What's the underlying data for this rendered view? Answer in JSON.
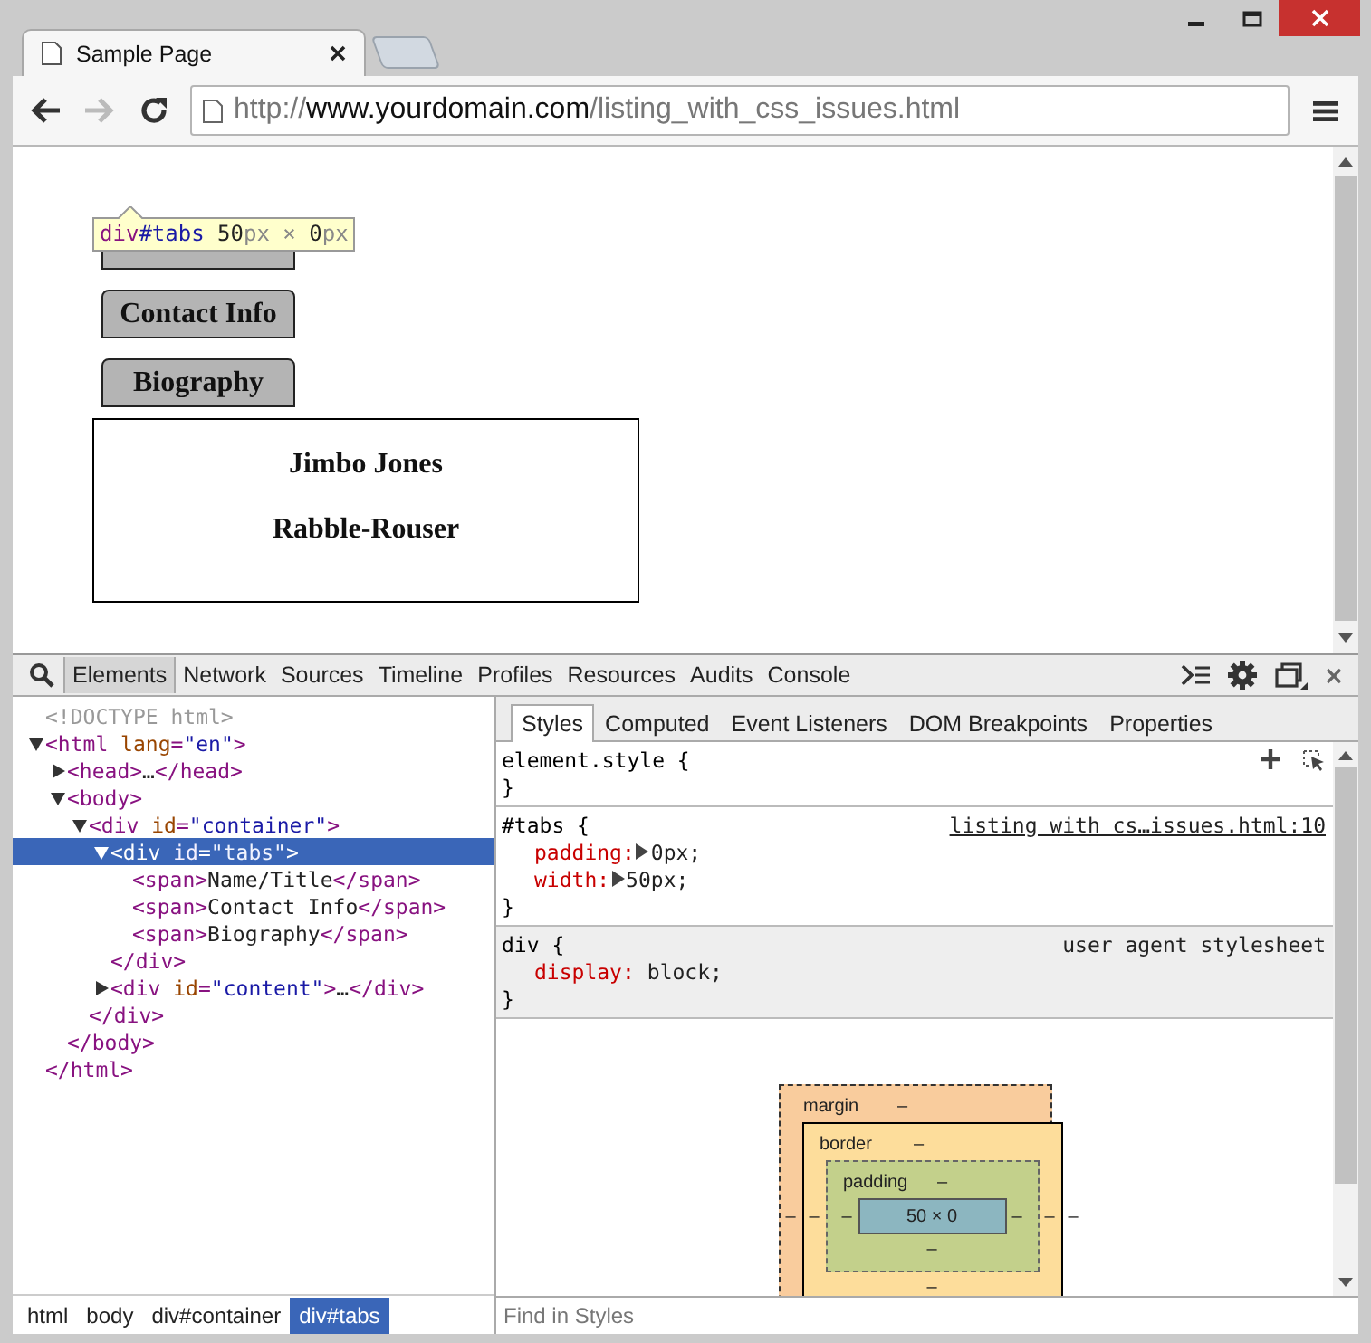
{
  "browser_tabs": [
    {
      "title": "Sample Page",
      "selected": true
    }
  ],
  "navigation": {
    "back_enabled": true,
    "forward_enabled": false
  },
  "address_bar": {
    "scheme": "http://",
    "host": "www.yourdomain.com",
    "path": "/listing_with_css_issues.html"
  },
  "page": {
    "tabs": [
      {
        "kind": "covered"
      },
      {
        "kind": "labeled",
        "label": "Contact Info"
      },
      {
        "kind": "labeled",
        "label": "Biography"
      }
    ],
    "content": [
      "Jimbo Jones",
      "Rabble-Rouser"
    ],
    "tooltip": [
      {
        "kind": "tag",
        "text": "div"
      },
      {
        "kind": "value",
        "text": "#tabs"
      },
      {
        "kind": "text",
        "text": " 50"
      },
      {
        "kind": "unit",
        "text": "px × "
      },
      {
        "kind": "text",
        "text": "0"
      },
      {
        "kind": "unit",
        "text": "px"
      }
    ]
  },
  "devtools": {
    "tabs": [
      {
        "label": "Elements",
        "selected": true
      },
      {
        "label": "Network",
        "selected": false
      },
      {
        "label": "Sources",
        "selected": false
      },
      {
        "label": "Timeline",
        "selected": false
      },
      {
        "label": "Profiles",
        "selected": false
      },
      {
        "label": "Resources",
        "selected": false
      },
      {
        "label": "Audits",
        "selected": false
      },
      {
        "label": "Console",
        "selected": false
      }
    ],
    "dom_tree": [
      {
        "selected": false,
        "tokens": [
          {
            "kind": "doctype",
            "text": "<!DOCTYPE html>"
          }
        ]
      },
      {
        "selected": false,
        "expanded": true,
        "tokens": [
          {
            "kind": "tag",
            "text": "<html "
          },
          {
            "kind": "attr",
            "text": "lang"
          },
          {
            "kind": "tag",
            "text": "="
          },
          {
            "kind": "value",
            "text": "\"en\""
          },
          {
            "kind": "tag",
            "text": ">"
          }
        ],
        "close": [
          {
            "kind": "tag",
            "text": "</html>"
          }
        ],
        "children": [
          {
            "selected": false,
            "expanded": false,
            "tokens": [
              {
                "kind": "tag",
                "text": "<head>"
              },
              {
                "kind": "text",
                "text": "…"
              },
              {
                "kind": "tag",
                "text": "</head>"
              }
            ]
          },
          {
            "selected": false,
            "expanded": true,
            "tokens": [
              {
                "kind": "tag",
                "text": "<body>"
              }
            ],
            "close": [
              {
                "kind": "tag",
                "text": "</body>"
              }
            ],
            "children": [
              {
                "selected": false,
                "expanded": true,
                "tokens": [
                  {
                    "kind": "tag",
                    "text": "<div "
                  },
                  {
                    "kind": "attr",
                    "text": "id"
                  },
                  {
                    "kind": "tag",
                    "text": "="
                  },
                  {
                    "kind": "value",
                    "text": "\"container\""
                  },
                  {
                    "kind": "tag",
                    "text": ">"
                  }
                ],
                "close": [
                  {
                    "kind": "tag",
                    "text": "</div>"
                  }
                ],
                "children": [
                  {
                    "selected": true,
                    "expanded": true,
                    "tokens": [
                      {
                        "kind": "tag",
                        "text": "<div "
                      },
                      {
                        "kind": "attr",
                        "text": "id"
                      },
                      {
                        "kind": "tag",
                        "text": "="
                      },
                      {
                        "kind": "value",
                        "text": "\"tabs\""
                      },
                      {
                        "kind": "tag",
                        "text": ">"
                      }
                    ],
                    "close": [
                      {
                        "kind": "tag",
                        "text": "</div>"
                      }
                    ],
                    "children": [
                      {
                        "selected": false,
                        "tokens": [
                          {
                            "kind": "tag",
                            "text": "<span>"
                          },
                          {
                            "kind": "text",
                            "text": "Name/Title"
                          },
                          {
                            "kind": "tag",
                            "text": "</span>"
                          }
                        ]
                      },
                      {
                        "selected": false,
                        "tokens": [
                          {
                            "kind": "tag",
                            "text": "<span>"
                          },
                          {
                            "kind": "text",
                            "text": "Contact Info"
                          },
                          {
                            "kind": "tag",
                            "text": "</span>"
                          }
                        ]
                      },
                      {
                        "selected": false,
                        "tokens": [
                          {
                            "kind": "tag",
                            "text": "<span>"
                          },
                          {
                            "kind": "text",
                            "text": "Biography"
                          },
                          {
                            "kind": "tag",
                            "text": "</span>"
                          }
                        ]
                      }
                    ]
                  },
                  {
                    "selected": false,
                    "expanded": false,
                    "tokens": [
                      {
                        "kind": "tag",
                        "text": "<div "
                      },
                      {
                        "kind": "attr",
                        "text": "id"
                      },
                      {
                        "kind": "tag",
                        "text": "="
                      },
                      {
                        "kind": "value",
                        "text": "\"content\""
                      },
                      {
                        "kind": "tag",
                        "text": ">"
                      },
                      {
                        "kind": "text",
                        "text": "…"
                      },
                      {
                        "kind": "tag",
                        "text": "</div>"
                      }
                    ]
                  }
                ]
              }
            ]
          }
        ]
      }
    ],
    "breadcrumbs": [
      {
        "label": "html",
        "selected": false
      },
      {
        "label": "body",
        "selected": false
      },
      {
        "label": "div#container",
        "selected": false
      },
      {
        "label": "div#tabs",
        "selected": true
      }
    ],
    "styles": {
      "tabs": [
        {
          "label": "Styles",
          "selected": true
        },
        {
          "label": "Computed",
          "selected": false
        },
        {
          "label": "Event Listeners",
          "selected": false
        },
        {
          "label": "DOM Breakpoints",
          "selected": false
        },
        {
          "label": "Properties",
          "selected": false
        }
      ],
      "rules": [
        {
          "selector": "element.style {",
          "tools": true,
          "shaded": false,
          "closing": "}"
        },
        {
          "selector": "#tabs {",
          "source": "listing with cs…issues.html:10",
          "link": true,
          "shaded": false,
          "declarations": [
            {
              "name": "padding:",
              "value": "0px;",
              "expandable": true
            },
            {
              "name": "width:",
              "value": "50px;",
              "expandable": true
            }
          ],
          "closing": "}"
        },
        {
          "selector": "div {",
          "source": "user agent stylesheet",
          "link": false,
          "shaded": true,
          "declarations": [
            {
              "name": "display:",
              "value": "block;",
              "expandable": false
            }
          ],
          "closing": "}"
        }
      ],
      "box_model": {
        "margin": {
          "label": "margin",
          "top": "–",
          "left": "–",
          "right": "–"
        },
        "border": {
          "label": "border",
          "top": "–",
          "left": "–",
          "right": "–",
          "bottom": "–"
        },
        "padding": {
          "label": "padding",
          "top": "–",
          "left": "–",
          "right": "–",
          "bottom": "–"
        },
        "content": "50 × 0"
      },
      "filter": {
        "placeholder": "Find in Styles"
      }
    }
  }
}
